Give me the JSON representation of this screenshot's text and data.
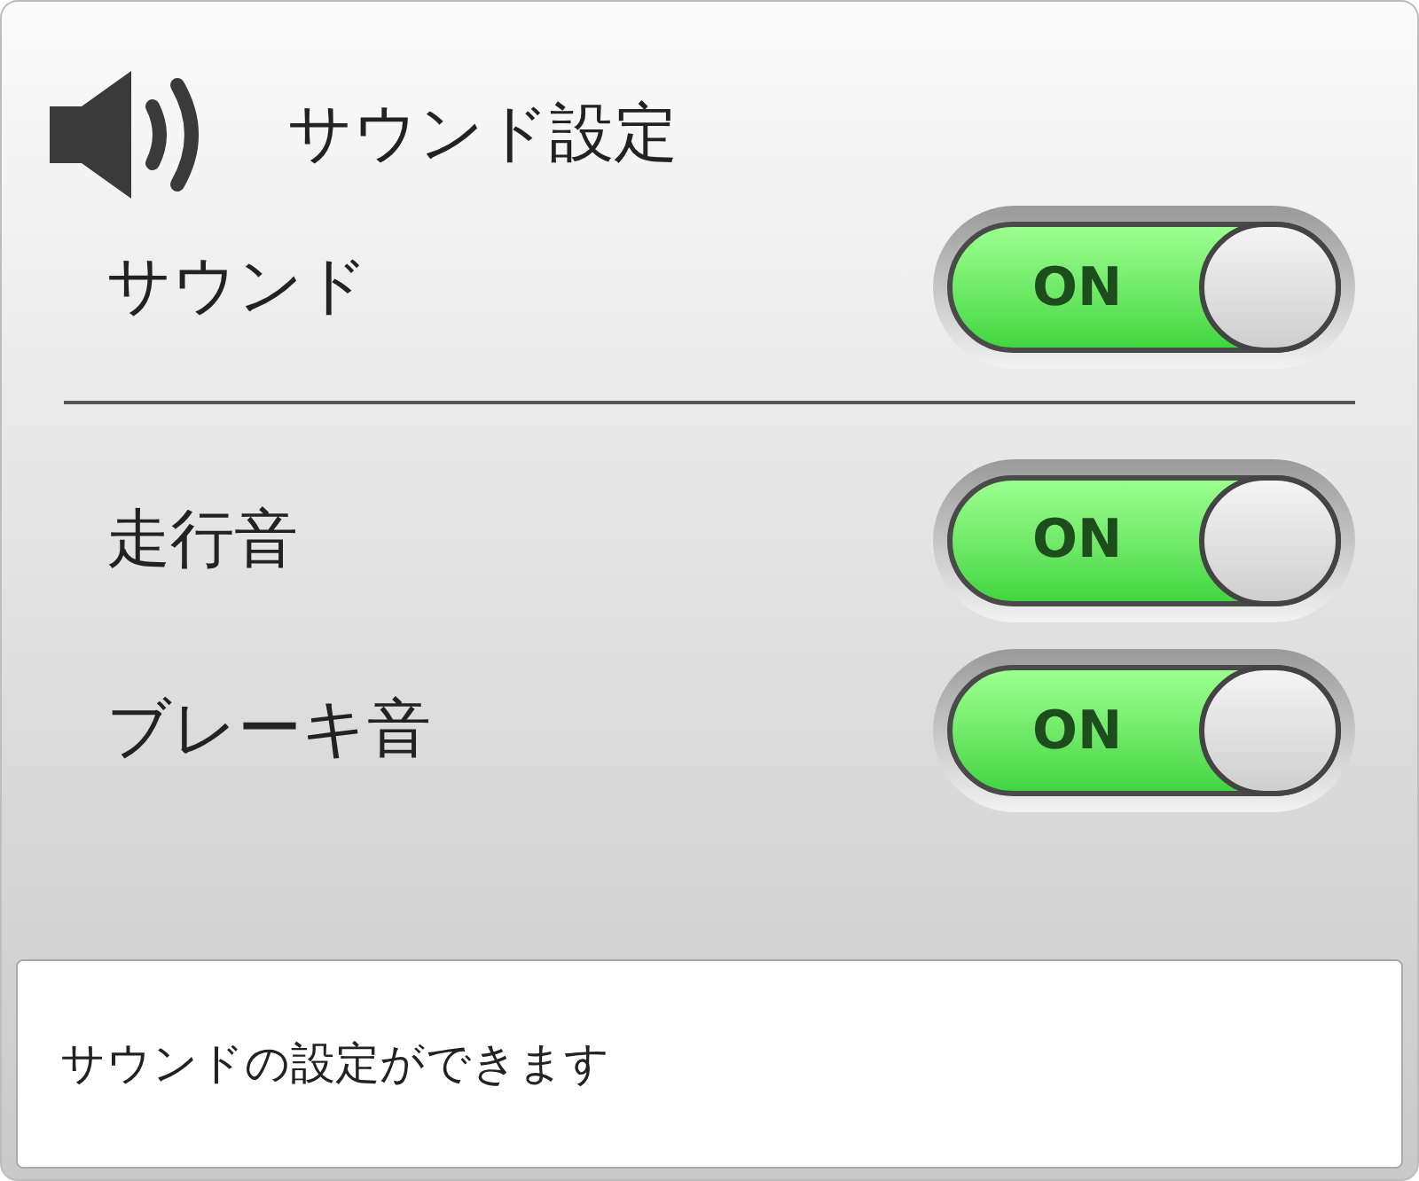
{
  "title": "サウンド設定",
  "settings": [
    {
      "label": "サウンド",
      "on": true,
      "state_text": "ON"
    },
    {
      "label": "走行音",
      "on": true,
      "state_text": "ON"
    },
    {
      "label": "ブレーキ音",
      "on": true,
      "state_text": "ON"
    }
  ],
  "description": "サウンドの設定ができます"
}
